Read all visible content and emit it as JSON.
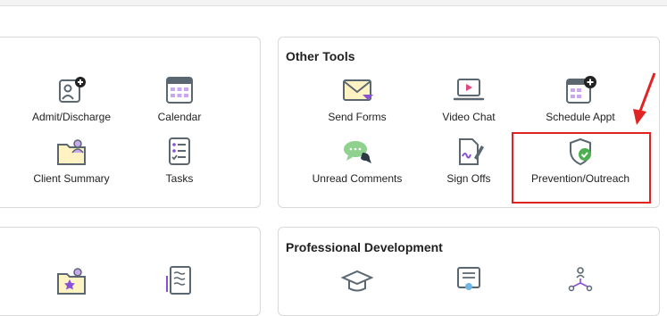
{
  "cards": {
    "left_top": {
      "tiles": [
        {
          "label": "Admit/Discharge",
          "icon": "admit-discharge-icon"
        },
        {
          "label": "Calendar",
          "icon": "calendar-icon"
        },
        {
          "label": "Client Summary",
          "icon": "client-summary-icon"
        },
        {
          "label": "Tasks",
          "icon": "tasks-icon"
        }
      ]
    },
    "other_tools": {
      "title": "Other Tools",
      "tiles": [
        {
          "label": "Send Forms",
          "icon": "envelope-icon"
        },
        {
          "label": "Video Chat",
          "icon": "video-chat-icon"
        },
        {
          "label": "Schedule Appt",
          "icon": "schedule-appt-icon"
        },
        {
          "label": "Unread Comments",
          "icon": "comments-icon"
        },
        {
          "label": "Sign Offs",
          "icon": "sign-offs-icon"
        },
        {
          "label": "Prevention/Outreach",
          "icon": "shield-check-icon"
        }
      ]
    },
    "left_bottom": {
      "tiles": [
        {
          "icon": "folder-star-icon"
        },
        {
          "icon": "notes-icon"
        }
      ]
    },
    "professional_development": {
      "title": "Professional Development",
      "tiles": [
        {
          "icon": "graduation-cap-icon"
        },
        {
          "icon": "certificate-icon"
        },
        {
          "icon": "org-chart-icon"
        }
      ]
    }
  },
  "colors": {
    "accent_purple": "#8a4fd8",
    "highlight_red": "#e02424",
    "shield_green": "#4caf50",
    "icon_gray": "#5b6770"
  }
}
